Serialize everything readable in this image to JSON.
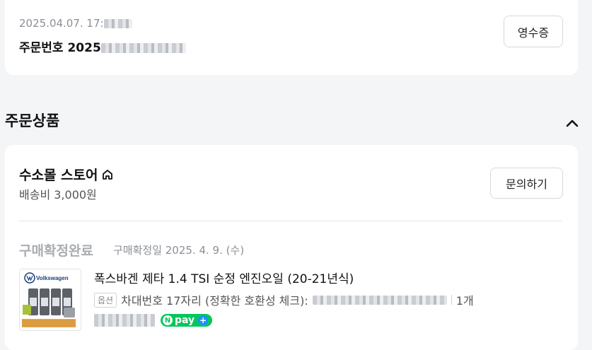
{
  "order": {
    "datetime": "2025.04.07. 17:",
    "number_prefix": "주문번호 2025",
    "receipt_button": "영수증"
  },
  "section": {
    "title": "주문상품"
  },
  "store": {
    "name": "수소몰 스토어",
    "shipping_fee": "배송비 3,000원",
    "inquiry_button": "문의하기"
  },
  "item": {
    "status": "구매확정완료",
    "confirm_date": "구매확정일 2025. 4. 9. (수)",
    "thumbnail_brand": "Volkswagen",
    "title": "폭스바겐 제타 1.4 TSI 순정 엔진오일 (20-21년식)",
    "option_tag": "옵션",
    "option_text": "차대번호 17자리 (정확한 호환성 체크):",
    "quantity": "1개",
    "pay_label": "pay"
  }
}
